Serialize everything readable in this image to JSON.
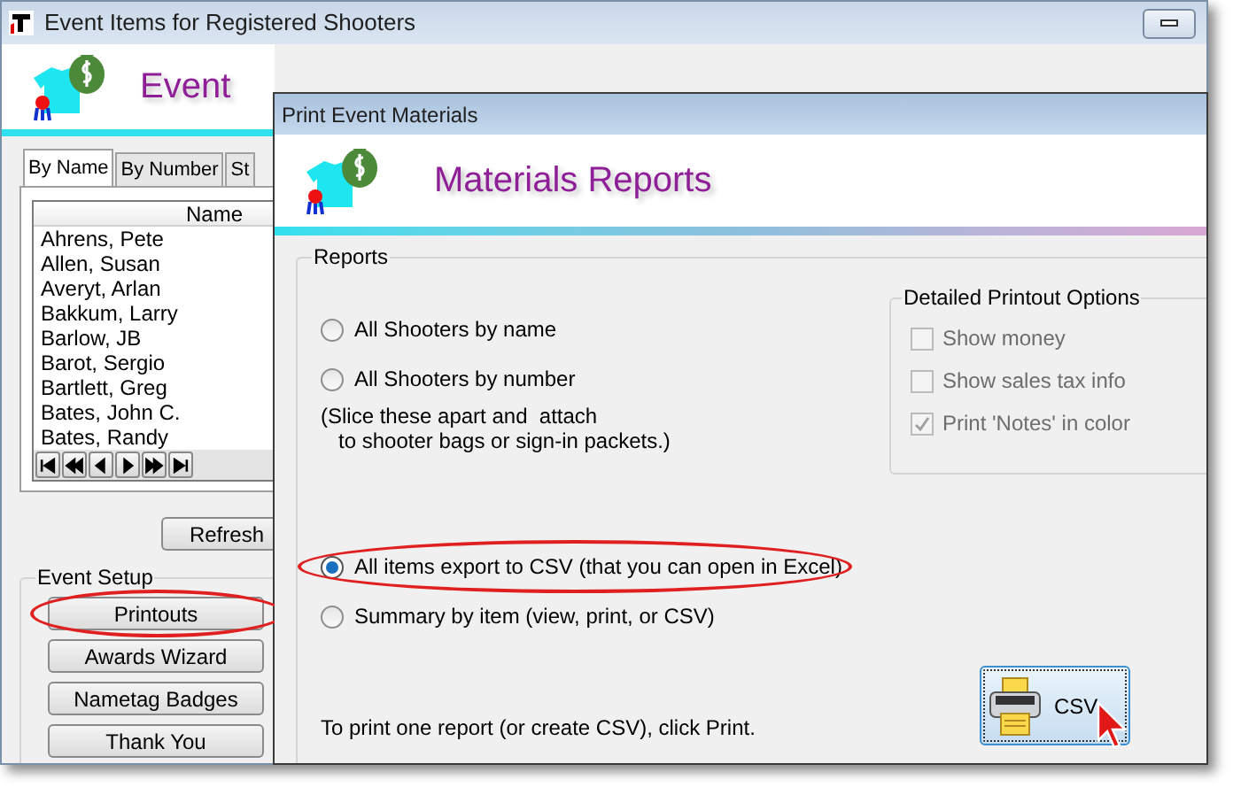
{
  "main_window": {
    "title": "Event Items for Registered Shooters",
    "header": "Event",
    "tabs": [
      {
        "label": "By Name",
        "selected": true
      },
      {
        "label": "By Number",
        "selected": false
      },
      {
        "label": "St",
        "selected": false
      }
    ],
    "list": {
      "column": "Name",
      "rows": [
        "Ahrens, Pete",
        "Allen, Susan",
        "Averyt, Arlan",
        "Bakkum, Larry",
        "Barlow, JB",
        "Barot, Sergio",
        "Bartlett, Greg",
        "Bates, John C.",
        "Bates, Randy"
      ]
    },
    "refresh_button": "Refresh",
    "event_setup": {
      "title": "Event Setup",
      "buttons": [
        {
          "label": "Printouts",
          "highlighted": true
        },
        {
          "label": "Awards Wizard",
          "highlighted": false
        },
        {
          "label": "Nametag Badges",
          "highlighted": false
        },
        {
          "label": "Thank You",
          "highlighted": false
        }
      ]
    }
  },
  "dialog": {
    "title": "Print Event Materials",
    "header": "Materials Reports",
    "reports": {
      "title": "Reports",
      "items": [
        {
          "kind": "radio",
          "label": "All Shooters by name",
          "selected": false,
          "highlighted": false
        },
        {
          "kind": "radio",
          "label": "All Shooters by number",
          "selected": false,
          "highlighted": false
        },
        {
          "kind": "note",
          "label": "(Slice these apart and  attach\n   to shooter bags or sign-in packets.)"
        },
        {
          "kind": "radio",
          "label": "All items export to CSV (that you can open in Excel)",
          "selected": true,
          "highlighted": true
        },
        {
          "kind": "radio",
          "label": "Summary by item (view, print, or CSV)",
          "selected": false,
          "highlighted": false
        }
      ]
    },
    "options": {
      "title": "Detailed Printout Options",
      "items": [
        {
          "label": "Show money",
          "checked": false,
          "disabled": true
        },
        {
          "label": "Show sales tax info",
          "checked": false,
          "disabled": true
        },
        {
          "label": "Print 'Notes' in color",
          "checked": true,
          "disabled": true
        }
      ]
    },
    "hint": "To print one report (or create CSV), click Print.",
    "action_button": "CSV"
  }
}
